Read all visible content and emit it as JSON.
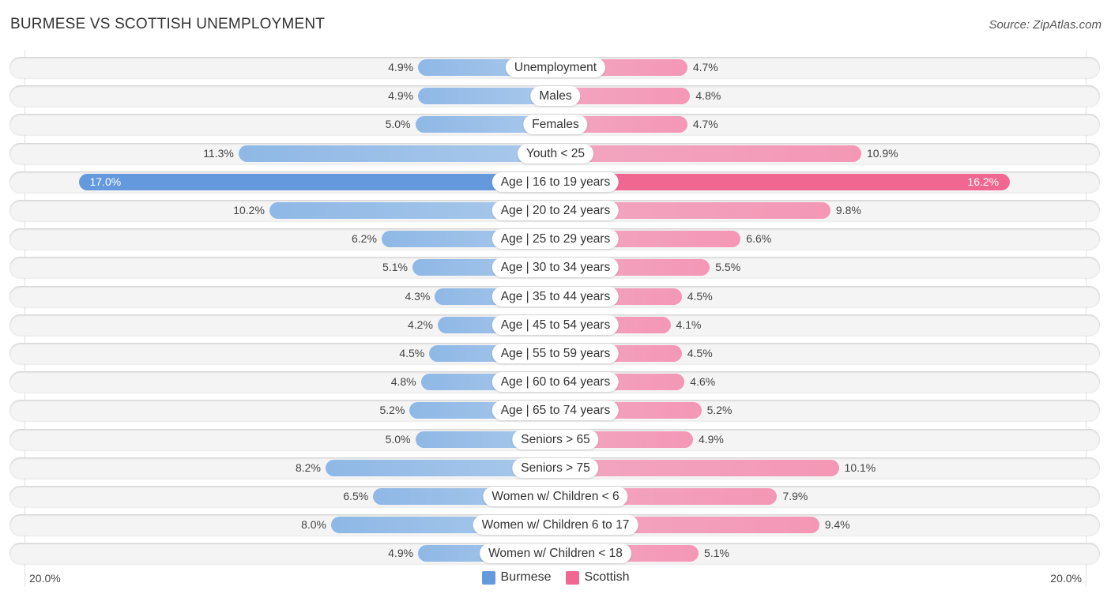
{
  "header": {
    "title": "BURMESE VS SCOTTISH UNEMPLOYMENT",
    "source": "Source: ZipAtlas.com"
  },
  "colors": {
    "burmese": "#6499dd",
    "scottish": "#f06792",
    "burmese_light": "#a9c9eb",
    "scottish_light": "#f497b6"
  },
  "chart_data": {
    "type": "bar",
    "orientation": "horizontal-diverging",
    "title": "BURMESE VS SCOTTISH UNEMPLOYMENT",
    "xlabel": "",
    "ylabel": "",
    "xlim": [
      -20.0,
      20.0
    ],
    "axis_labels": {
      "left": "20.0%",
      "right": "20.0%"
    },
    "legend": {
      "position": "bottom-center",
      "entries": [
        "Burmese",
        "Scottish"
      ]
    },
    "highlighted_category": "Age | 16 to 19 years",
    "categories": [
      "Unemployment",
      "Males",
      "Females",
      "Youth < 25",
      "Age | 16 to 19 years",
      "Age | 20 to 24 years",
      "Age | 25 to 29 years",
      "Age | 30 to 34 years",
      "Age | 35 to 44 years",
      "Age | 45 to 54 years",
      "Age | 55 to 59 years",
      "Age | 60 to 64 years",
      "Age | 65 to 74 years",
      "Seniors > 65",
      "Seniors > 75",
      "Women w/ Children < 6",
      "Women w/ Children 6 to 17",
      "Women w/ Children < 18"
    ],
    "series": [
      {
        "name": "Burmese",
        "values": [
          4.9,
          4.9,
          5.0,
          11.3,
          17.0,
          10.2,
          6.2,
          5.1,
          4.3,
          4.2,
          4.5,
          4.8,
          5.2,
          5.0,
          8.2,
          6.5,
          8.0,
          4.9
        ],
        "labels": [
          "4.9%",
          "4.9%",
          "5.0%",
          "11.3%",
          "17.0%",
          "10.2%",
          "6.2%",
          "5.1%",
          "4.3%",
          "4.2%",
          "4.5%",
          "4.8%",
          "5.2%",
          "5.0%",
          "8.2%",
          "6.5%",
          "8.0%",
          "4.9%"
        ]
      },
      {
        "name": "Scottish",
        "values": [
          4.7,
          4.8,
          4.7,
          10.9,
          16.2,
          9.8,
          6.6,
          5.5,
          4.5,
          4.1,
          4.5,
          4.6,
          5.2,
          4.9,
          10.1,
          7.9,
          9.4,
          5.1
        ],
        "labels": [
          "4.7%",
          "4.8%",
          "4.7%",
          "10.9%",
          "16.2%",
          "9.8%",
          "6.6%",
          "5.5%",
          "4.5%",
          "4.1%",
          "4.5%",
          "4.6%",
          "5.2%",
          "4.9%",
          "10.1%",
          "7.9%",
          "9.4%",
          "5.1%"
        ]
      }
    ]
  }
}
